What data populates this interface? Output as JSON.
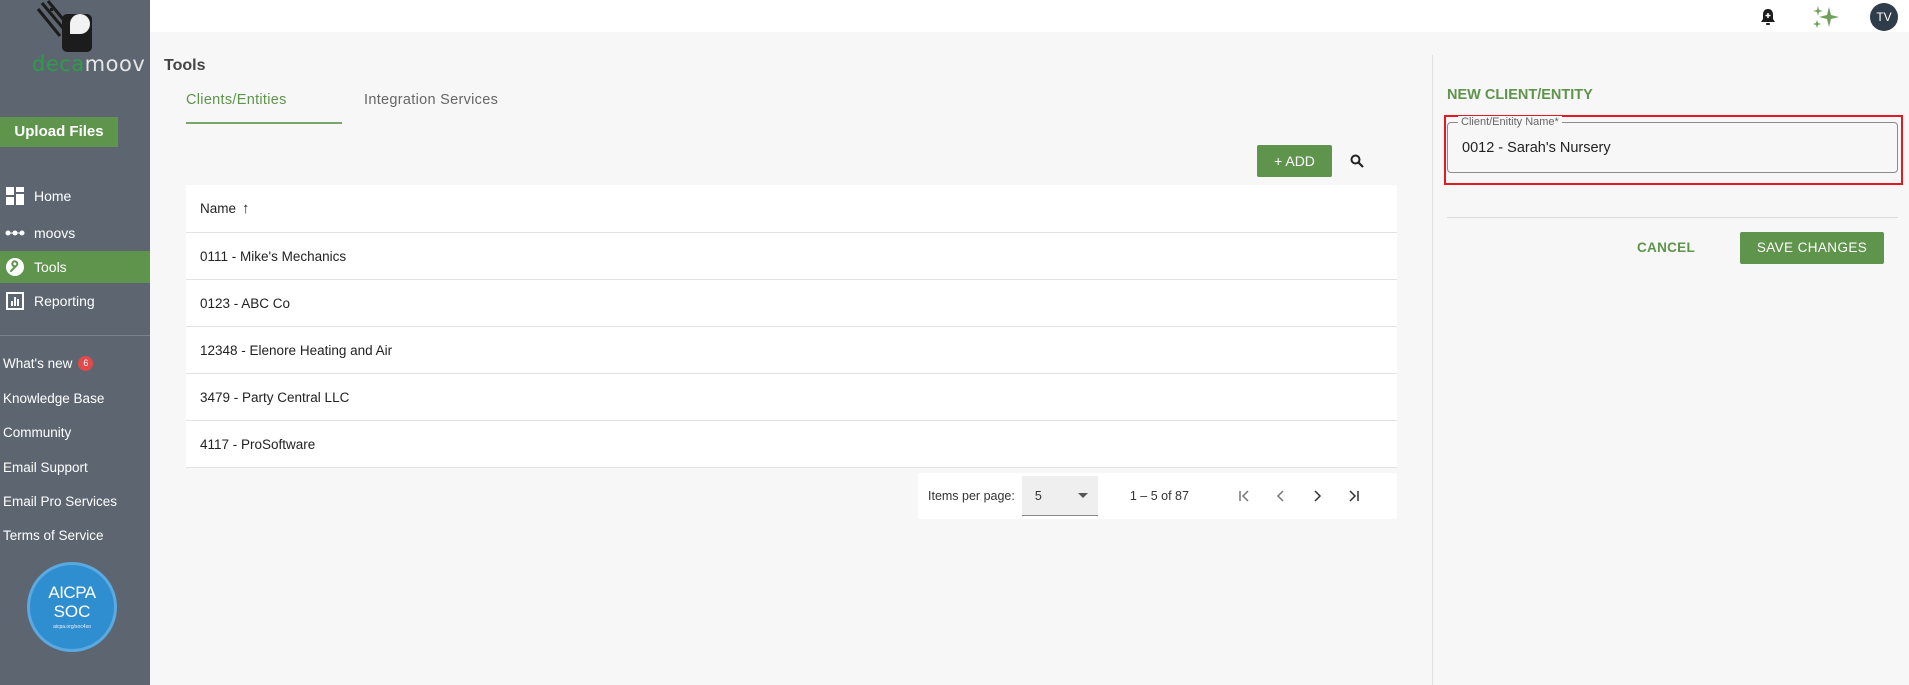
{
  "sidebar": {
    "logo_text_1": "deca",
    "logo_text_2": "moov",
    "upload_label": "Upload Files",
    "nav": [
      {
        "label": "Home",
        "icon": "grid-icon"
      },
      {
        "label": "moovs",
        "icon": "dots-icon"
      },
      {
        "label": "Tools",
        "icon": "wrench-icon",
        "active": true
      },
      {
        "label": "Reporting",
        "icon": "chart-icon"
      }
    ],
    "links": [
      {
        "label": "What's new",
        "badge": "6"
      },
      {
        "label": "Knowledge Base"
      },
      {
        "label": "Community"
      },
      {
        "label": "Email Support"
      },
      {
        "label": "Email Pro Services"
      },
      {
        "label": "Terms of Service"
      }
    ],
    "aicpa": {
      "line1": "AICPA",
      "line2": "SOC",
      "line3": "aicpa.org/soc4so"
    }
  },
  "topbar": {
    "avatar_initials": "TV",
    "icons": [
      "bell-icon",
      "sparkle-icon"
    ]
  },
  "main": {
    "title": "Tools",
    "tabs": [
      {
        "label": "Clients/Entities",
        "active": true
      },
      {
        "label": "Integration Services"
      }
    ],
    "add_label": "+ ADD",
    "table": {
      "header": "Name",
      "sort": "asc",
      "rows": [
        "0111 - Mike's Mechanics",
        "0123 - ABC Co",
        "12348 - Elenore Heating and Air",
        "3479 - Party Central LLC",
        "4117 - ProSoftware"
      ]
    },
    "pager": {
      "items_per_page_label": "Items per page:",
      "items_per_page_value": "5",
      "range": "1 – 5 of 87"
    }
  },
  "panel": {
    "title": "NEW CLIENT/ENTITY",
    "field_label": "Client/Enitity Name*",
    "field_value": "0012 - Sarah's Nursery",
    "cancel_label": "CANCEL",
    "save_label": "SAVE CHANGES"
  },
  "colors": {
    "accent": "#5f944c",
    "sidebar": "#5d6670",
    "highlight": "#e01b24"
  }
}
